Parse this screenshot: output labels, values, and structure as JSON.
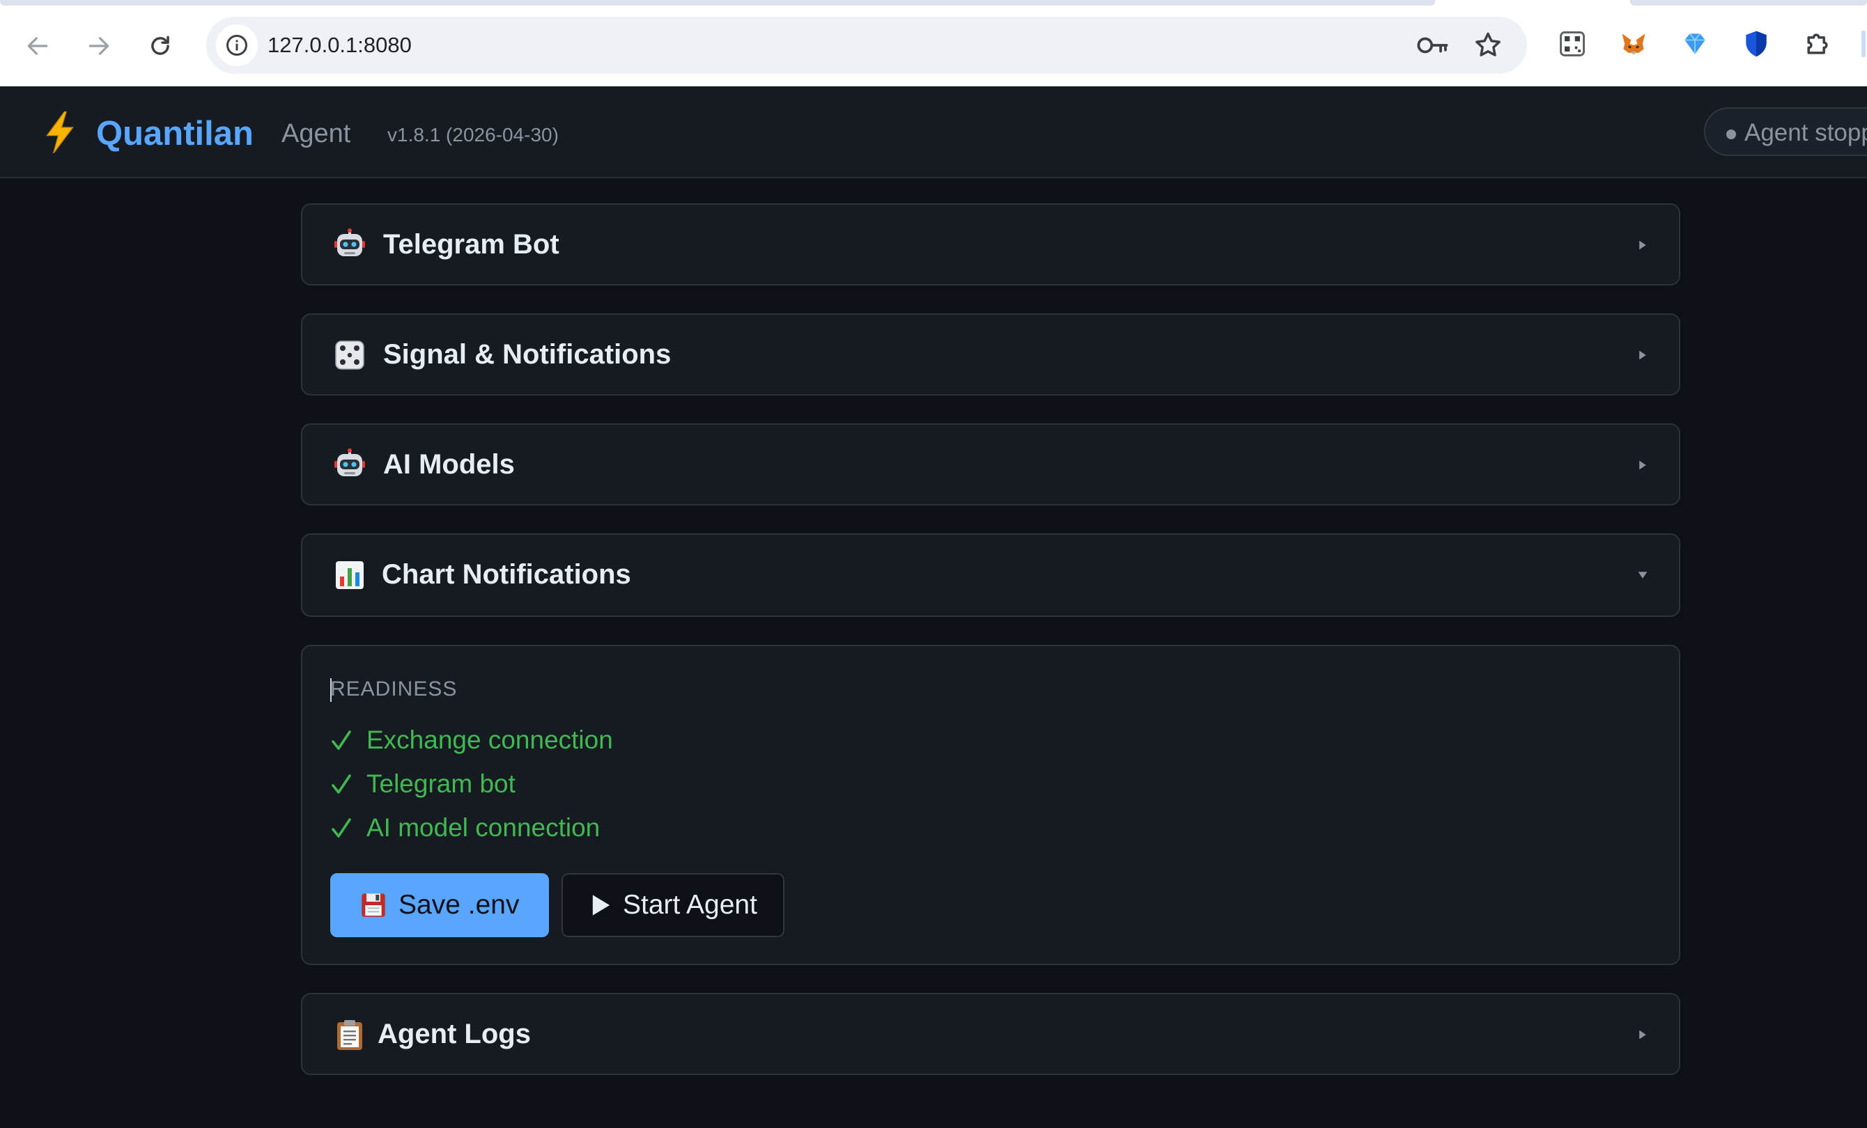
{
  "browser": {
    "url": "127.0.0.1:8080"
  },
  "header": {
    "brand": "Quantilan",
    "subtitle": "Agent",
    "version": "v1.8.1 (2026-04-30)",
    "status": "Agent stopped"
  },
  "sections": [
    {
      "title": "Telegram Bot",
      "icon": "robot-icon",
      "state": "collapsed"
    },
    {
      "title": "Signal & Notifications",
      "icon": "dice-icon",
      "state": "collapsed"
    },
    {
      "title": "AI Models",
      "icon": "robot-icon",
      "state": "collapsed"
    },
    {
      "title": "Chart Notifications",
      "icon": "bar-chart-icon",
      "state": "expanded"
    },
    {
      "title": "Agent Logs",
      "icon": "clipboard-icon",
      "state": "collapsed"
    }
  ],
  "readiness": {
    "heading": "READINESS",
    "items": [
      {
        "label": "Exchange connection",
        "ok": true
      },
      {
        "label": "Telegram bot",
        "ok": true
      },
      {
        "label": "AI model connection",
        "ok": true
      }
    ]
  },
  "actions": {
    "save_label": "Save .env",
    "start_label": "Start Agent"
  },
  "colors": {
    "background": "#0d1117",
    "panel": "#161b22",
    "accent": "#58a6ff",
    "success": "#3fb950",
    "muted": "#8b949e"
  }
}
